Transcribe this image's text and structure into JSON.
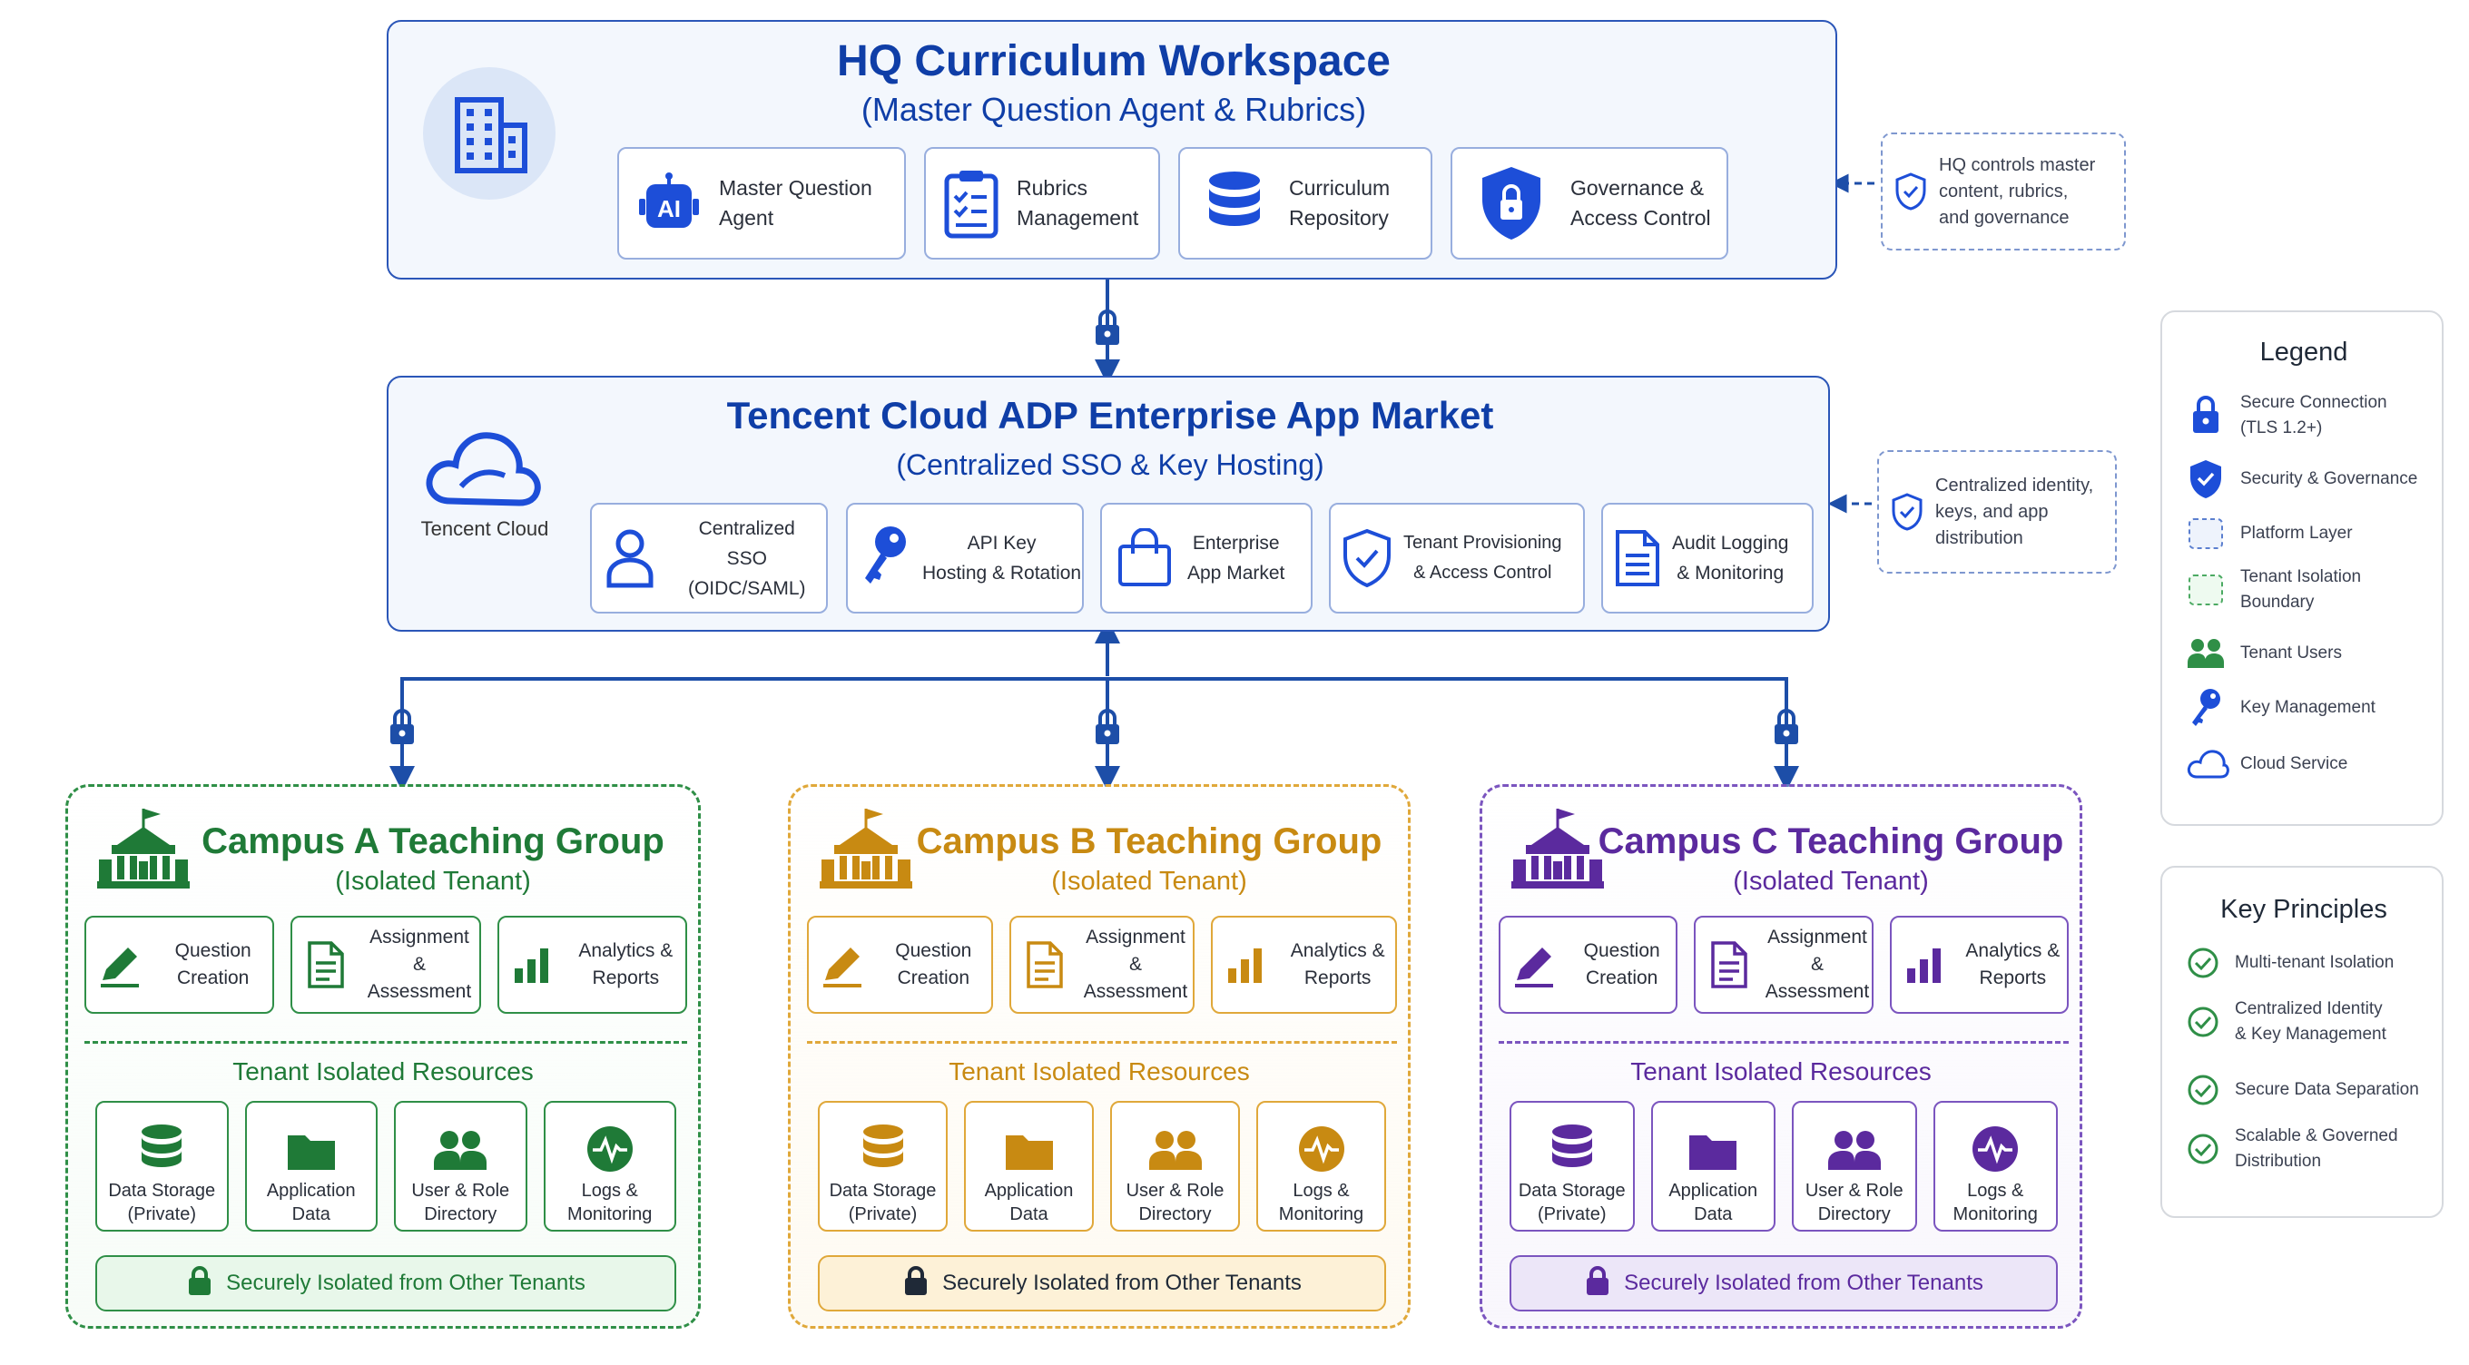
{
  "hq": {
    "title": "HQ Curriculum Workspace",
    "subtitle": "(Master Question Agent & Rubrics)",
    "ai_badge": "AI",
    "cards": [
      {
        "label": "Master Question\nAgent",
        "icon": "ai-robot-icon"
      },
      {
        "label": "Rubrics\nManagement",
        "icon": "clipboard-checklist-icon"
      },
      {
        "label": "Curriculum\nRepository",
        "icon": "database-icon"
      },
      {
        "label": "Governance &\nAccess Control",
        "icon": "shield-lock-icon"
      }
    ],
    "note": "HQ controls master\ncontent, rubrics,\nand governance"
  },
  "market": {
    "title": "Tencent Cloud ADP Enterprise App Market",
    "subtitle": "(Centralized SSO & Key Hosting)",
    "logo_label": "Tencent Cloud",
    "cards": [
      {
        "label": "Centralized\nSSO (OIDC/SAML)",
        "icon": "user-icon"
      },
      {
        "label": "API Key\nHosting & Rotation",
        "icon": "key-icon"
      },
      {
        "label": "Enterprise\nApp Market",
        "icon": "shopping-bag-icon"
      },
      {
        "label": "Tenant Provisioning\n& Access Control",
        "icon": "shield-check-icon"
      },
      {
        "label": "Audit Logging\n& Monitoring",
        "icon": "document-icon"
      }
    ],
    "note": "Centralized identity,\nkeys, and app\ndistribution"
  },
  "tenants": [
    {
      "title": "Campus A Teaching Group",
      "subtitle": "(Isolated Tenant)",
      "color": "#1f7a37",
      "light": "#e8f7ea",
      "border": "#2f8f47",
      "apps": [
        "Question\nCreation",
        "Assignment\n& Assessment",
        "Analytics &\nReports"
      ],
      "resources_title": "Tenant Isolated Resources",
      "resources": [
        "Data Storage\n(Private)",
        "Application\nData",
        "User & Role\nDirectory",
        "Logs &\nMonitoring"
      ],
      "footer": "Securely Isolated from Other Tenants"
    },
    {
      "title": "Campus B Teaching Group",
      "subtitle": "(Isolated Tenant)",
      "color": "#c88a12",
      "light": "#fdf1d7",
      "border": "#e0a83a",
      "apps": [
        "Question\nCreation",
        "Assignment\n& Assessment",
        "Analytics &\nReports"
      ],
      "resources_title": "Tenant Isolated Resources",
      "resources": [
        "Data Storage\n(Private)",
        "Application\nData",
        "User & Role\nDirectory",
        "Logs &\nMonitoring"
      ],
      "footer": "Securely Isolated from Other Tenants"
    },
    {
      "title": "Campus C Teaching Group",
      "subtitle": "(Isolated Tenant)",
      "color": "#5b2a9e",
      "light": "#ece6f8",
      "border": "#7b55bf",
      "apps": [
        "Question\nCreation",
        "Assignment\n& Assessment",
        "Analytics &\nReports"
      ],
      "resources_title": "Tenant Isolated Resources",
      "resources": [
        "Data Storage\n(Private)",
        "Application\nData",
        "User & Role\nDirectory",
        "Logs &\nMonitoring"
      ],
      "footer": "Securely Isolated from Other Tenants"
    }
  ],
  "legend": {
    "title": "Legend",
    "items": [
      {
        "label": "Secure Connection\n(TLS 1.2+)",
        "icon": "padlock-icon"
      },
      {
        "label": "Security & Governance",
        "icon": "shield-check-icon"
      },
      {
        "label": "Platform Layer",
        "icon": "blue-dashed-box-icon"
      },
      {
        "label": "Tenant Isolation\nBoundary",
        "icon": "green-dashed-box-icon"
      },
      {
        "label": "Tenant Users",
        "icon": "users-icon"
      },
      {
        "label": "Key Management",
        "icon": "key-icon"
      },
      {
        "label": "Cloud Service",
        "icon": "cloud-icon"
      }
    ]
  },
  "principles": {
    "title": "Key Principles",
    "items": [
      "Multi-tenant Isolation",
      "Centralized Identity\n& Key Management",
      "Secure Data Separation",
      "Scalable & Governed\nDistribution"
    ]
  },
  "colors": {
    "platform_blue": "#0f3ea7",
    "icon_blue": "#1d4ed8",
    "connector": "#1d4ea8"
  }
}
